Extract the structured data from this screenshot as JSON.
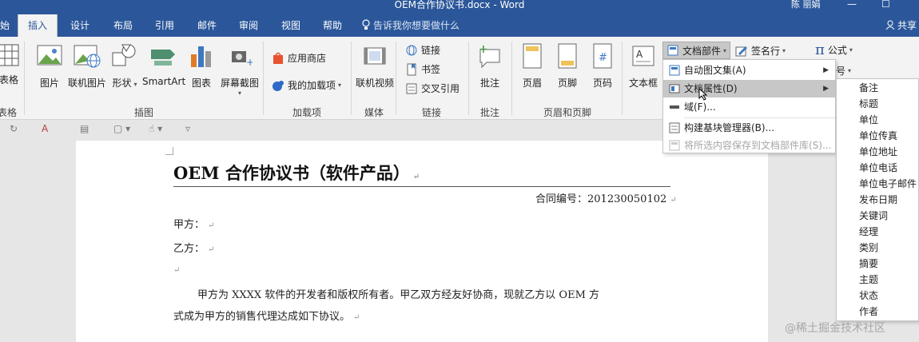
{
  "window": {
    "title": "OEM合作协议书.docx - Word",
    "user": "陈 丽娟",
    "minimize": "—",
    "maximize": "☐"
  },
  "tabs": [
    {
      "label": "始"
    },
    {
      "label": "插入",
      "active": true
    },
    {
      "label": "设计"
    },
    {
      "label": "布局"
    },
    {
      "label": "引用"
    },
    {
      "label": "邮件"
    },
    {
      "label": "审阅"
    },
    {
      "label": "视图"
    },
    {
      "label": "帮助"
    }
  ],
  "tell_me": "告诉我你想要做什么",
  "share": "共享",
  "ribbon": {
    "table": {
      "label": "表格",
      "group": "表格"
    },
    "picture": "图片",
    "online_picture": "联机图片",
    "shapes": "形状",
    "smartart": "SmartArt",
    "chart": "图表",
    "screenshot": "屏幕截图",
    "illustrations_group": "插图",
    "store": "应用商店",
    "my_addins": "我的加载项",
    "addins_group": "加载项",
    "online_video": "联机视频",
    "media_group": "媒体",
    "link": "链接",
    "bookmark": "书签",
    "cross_ref": "交叉引用",
    "links_group": "链接",
    "comment": "批注",
    "comments_group": "批注",
    "header": "页眉",
    "footer": "页脚",
    "page_number": "页码",
    "header_footer_group": "页眉和页脚",
    "textbox": "文本框",
    "quick_parts": "文档部件",
    "signature_line": "签名行",
    "equation": "公式",
    "symbol": "号"
  },
  "menu": {
    "items": [
      {
        "label": "自动图文集(A)",
        "arrow": "▶"
      },
      {
        "label": "文档属性(D)",
        "arrow": "▶"
      },
      {
        "label": "域(F)..."
      },
      {
        "label": "构建基块管理器(B)..."
      },
      {
        "label": "将所选内容保存到文档部件库(S)..."
      }
    ]
  },
  "submenu": {
    "items": [
      "备注",
      "标题",
      "单位",
      "单位传真",
      "单位地址",
      "单位电话",
      "单位电子邮件",
      "发布日期",
      "关键词",
      "经理",
      "类别",
      "摘要",
      "主题",
      "状态",
      "作者"
    ]
  },
  "document": {
    "title": "OEM 合作协议书（软件产品）",
    "contract_no": "合同编号：201230050102",
    "party_a": "甲方：",
    "party_b": "乙方：",
    "para_line1": "甲方为 XXXX 软件的开发者和版权所有者。甲乙双方经友好协商，现就乙方以 OEM 方",
    "para_line2": "式成为甲方的销售代理达成如下协议。"
  },
  "watermark": "@稀土掘金技术社区",
  "colors": {
    "accent": "#2b579a",
    "menu_highlight": "#c7c7c7"
  }
}
